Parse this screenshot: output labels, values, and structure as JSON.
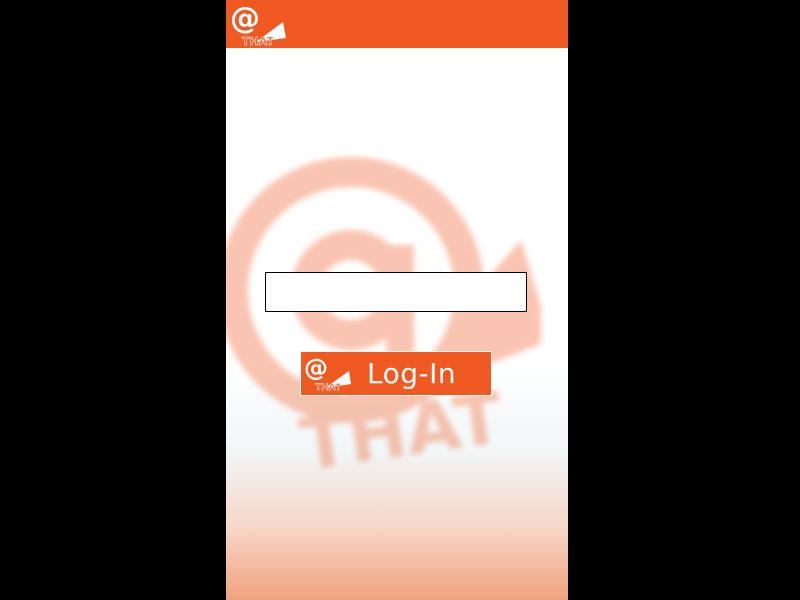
{
  "app": {
    "logo_icon": "at-that-logo-icon",
    "logo_text": "THAT",
    "logo_symbol": "@"
  },
  "login_form": {
    "username_value": "",
    "login_label": "Log-In",
    "button_icon": "at-that-logo-icon"
  },
  "colors": {
    "brand": "#f05a22",
    "background": "#ffffff",
    "frame": "#000000"
  }
}
